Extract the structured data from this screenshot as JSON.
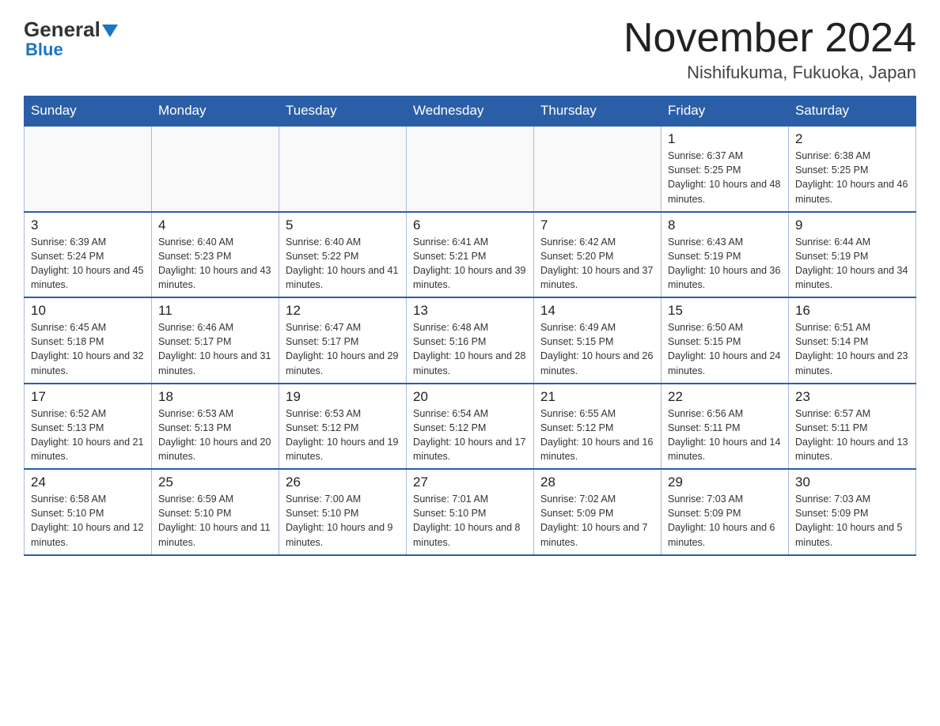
{
  "logo": {
    "general": "General",
    "blue": "Blue"
  },
  "title": "November 2024",
  "location": "Nishifukuma, Fukuoka, Japan",
  "days_header": [
    "Sunday",
    "Monday",
    "Tuesday",
    "Wednesday",
    "Thursday",
    "Friday",
    "Saturday"
  ],
  "weeks": [
    [
      {
        "day": "",
        "info": ""
      },
      {
        "day": "",
        "info": ""
      },
      {
        "day": "",
        "info": ""
      },
      {
        "day": "",
        "info": ""
      },
      {
        "day": "",
        "info": ""
      },
      {
        "day": "1",
        "info": "Sunrise: 6:37 AM\nSunset: 5:25 PM\nDaylight: 10 hours and 48 minutes."
      },
      {
        "day": "2",
        "info": "Sunrise: 6:38 AM\nSunset: 5:25 PM\nDaylight: 10 hours and 46 minutes."
      }
    ],
    [
      {
        "day": "3",
        "info": "Sunrise: 6:39 AM\nSunset: 5:24 PM\nDaylight: 10 hours and 45 minutes."
      },
      {
        "day": "4",
        "info": "Sunrise: 6:40 AM\nSunset: 5:23 PM\nDaylight: 10 hours and 43 minutes."
      },
      {
        "day": "5",
        "info": "Sunrise: 6:40 AM\nSunset: 5:22 PM\nDaylight: 10 hours and 41 minutes."
      },
      {
        "day": "6",
        "info": "Sunrise: 6:41 AM\nSunset: 5:21 PM\nDaylight: 10 hours and 39 minutes."
      },
      {
        "day": "7",
        "info": "Sunrise: 6:42 AM\nSunset: 5:20 PM\nDaylight: 10 hours and 37 minutes."
      },
      {
        "day": "8",
        "info": "Sunrise: 6:43 AM\nSunset: 5:19 PM\nDaylight: 10 hours and 36 minutes."
      },
      {
        "day": "9",
        "info": "Sunrise: 6:44 AM\nSunset: 5:19 PM\nDaylight: 10 hours and 34 minutes."
      }
    ],
    [
      {
        "day": "10",
        "info": "Sunrise: 6:45 AM\nSunset: 5:18 PM\nDaylight: 10 hours and 32 minutes."
      },
      {
        "day": "11",
        "info": "Sunrise: 6:46 AM\nSunset: 5:17 PM\nDaylight: 10 hours and 31 minutes."
      },
      {
        "day": "12",
        "info": "Sunrise: 6:47 AM\nSunset: 5:17 PM\nDaylight: 10 hours and 29 minutes."
      },
      {
        "day": "13",
        "info": "Sunrise: 6:48 AM\nSunset: 5:16 PM\nDaylight: 10 hours and 28 minutes."
      },
      {
        "day": "14",
        "info": "Sunrise: 6:49 AM\nSunset: 5:15 PM\nDaylight: 10 hours and 26 minutes."
      },
      {
        "day": "15",
        "info": "Sunrise: 6:50 AM\nSunset: 5:15 PM\nDaylight: 10 hours and 24 minutes."
      },
      {
        "day": "16",
        "info": "Sunrise: 6:51 AM\nSunset: 5:14 PM\nDaylight: 10 hours and 23 minutes."
      }
    ],
    [
      {
        "day": "17",
        "info": "Sunrise: 6:52 AM\nSunset: 5:13 PM\nDaylight: 10 hours and 21 minutes."
      },
      {
        "day": "18",
        "info": "Sunrise: 6:53 AM\nSunset: 5:13 PM\nDaylight: 10 hours and 20 minutes."
      },
      {
        "day": "19",
        "info": "Sunrise: 6:53 AM\nSunset: 5:12 PM\nDaylight: 10 hours and 19 minutes."
      },
      {
        "day": "20",
        "info": "Sunrise: 6:54 AM\nSunset: 5:12 PM\nDaylight: 10 hours and 17 minutes."
      },
      {
        "day": "21",
        "info": "Sunrise: 6:55 AM\nSunset: 5:12 PM\nDaylight: 10 hours and 16 minutes."
      },
      {
        "day": "22",
        "info": "Sunrise: 6:56 AM\nSunset: 5:11 PM\nDaylight: 10 hours and 14 minutes."
      },
      {
        "day": "23",
        "info": "Sunrise: 6:57 AM\nSunset: 5:11 PM\nDaylight: 10 hours and 13 minutes."
      }
    ],
    [
      {
        "day": "24",
        "info": "Sunrise: 6:58 AM\nSunset: 5:10 PM\nDaylight: 10 hours and 12 minutes."
      },
      {
        "day": "25",
        "info": "Sunrise: 6:59 AM\nSunset: 5:10 PM\nDaylight: 10 hours and 11 minutes."
      },
      {
        "day": "26",
        "info": "Sunrise: 7:00 AM\nSunset: 5:10 PM\nDaylight: 10 hours and 9 minutes."
      },
      {
        "day": "27",
        "info": "Sunrise: 7:01 AM\nSunset: 5:10 PM\nDaylight: 10 hours and 8 minutes."
      },
      {
        "day": "28",
        "info": "Sunrise: 7:02 AM\nSunset: 5:09 PM\nDaylight: 10 hours and 7 minutes."
      },
      {
        "day": "29",
        "info": "Sunrise: 7:03 AM\nSunset: 5:09 PM\nDaylight: 10 hours and 6 minutes."
      },
      {
        "day": "30",
        "info": "Sunrise: 7:03 AM\nSunset: 5:09 PM\nDaylight: 10 hours and 5 minutes."
      }
    ]
  ]
}
